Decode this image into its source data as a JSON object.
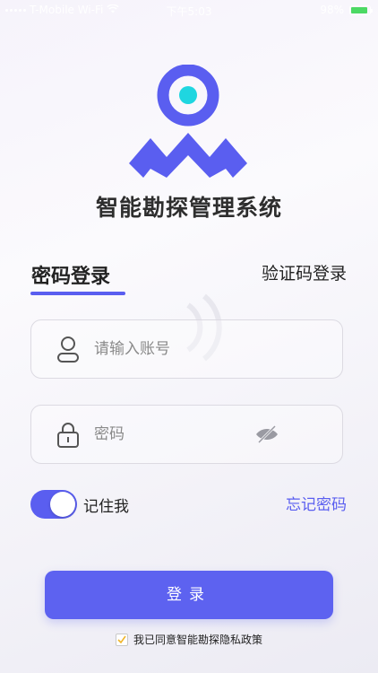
{
  "status_bar": {
    "carrier": "T-Mobile Wi-Fi",
    "time": "下午5:03",
    "battery": "98%"
  },
  "app": {
    "title": "智能勘探管理系统"
  },
  "tabs": {
    "password_login": "密码登录",
    "code_login": "验证码登录"
  },
  "form": {
    "account_placeholder": "请输入账号",
    "account_value": "",
    "password_placeholder": "密码",
    "password_value": ""
  },
  "options": {
    "remember_label": "记住我",
    "remember_enabled": true,
    "forgot_label": "忘记密码"
  },
  "actions": {
    "login_label": "登录"
  },
  "agreement": {
    "text": "我已同意智能勘探隐私政策",
    "checked": true
  },
  "colors": {
    "accent": "#5a5ef0",
    "logo_dot": "#1fd6e0"
  }
}
